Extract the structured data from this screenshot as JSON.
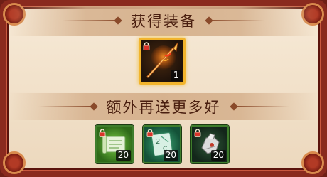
{
  "headers": {
    "obtained_equipment": "获得装备",
    "bonus_more": "额外再送更多好"
  },
  "main_item": {
    "icon": "spear-icon",
    "count": "1",
    "locked": true
  },
  "bonus_items": [
    {
      "icon": "scroll-icon",
      "count": "20",
      "locked": true
    },
    {
      "icon": "rune-card-icon",
      "count": "20",
      "locked": true
    },
    {
      "icon": "gauntlet-icon",
      "count": "20",
      "locked": true
    }
  ],
  "colors": {
    "frame": "#8a2a1e",
    "main_border": "#f2b42c",
    "bonus_border": "#3e7d2c",
    "title_text": "#4a1f10"
  }
}
